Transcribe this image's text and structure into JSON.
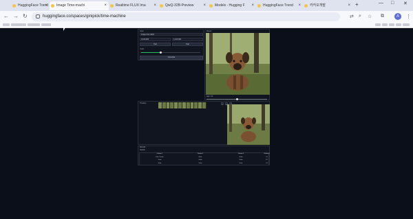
{
  "browser": {
    "tabs": [
      {
        "label": "HuggingFace Trend"
      },
      {
        "label": "Image Time-machi"
      },
      {
        "label": "Realtime FLUX Ima"
      },
      {
        "label": "QwQ-32B-Preview"
      },
      {
        "label": "Models - Hugging F"
      },
      {
        "label": "HuggingFace Trend"
      },
      {
        "label": "카카오개발"
      }
    ],
    "url": "huggingface.co/spaces/ginipick/time-machine",
    "avatar_letter": "A",
    "new_tab_symbol": "+",
    "back_symbol": "←",
    "forward_symbol": "→",
    "reload_symbol": "↻",
    "minimize_symbol": "—",
    "maximize_symbol": "□",
    "close_symbol": "✕",
    "tab_close_symbol": "×",
    "translate_icon_glyph": "⇄",
    "zoom_icon_glyph": "⌕",
    "star_icon_glyph": "☆",
    "extensions_icon_glyph": "⧉",
    "menu_icon_glyph": "⋮"
  },
  "app": {
    "controls": {
      "input_label": "Input",
      "input_value": "Image from 2024",
      "value_left": "2,100,000",
      "value_right": "1,100,000",
      "sub_left": "Year",
      "sub_right": "Year",
      "slider_label": "Years",
      "slider_value": 0.33,
      "generate_label": "Generate"
    },
    "top_image_label": "Result",
    "top_image_caption": "Age: 0.0",
    "top_slider_value": 0.5,
    "strip_label": "Timeline",
    "strip_frame_count": 12,
    "mid_buttons": [
      "−",
      "+",
      "⤢"
    ],
    "table": {
      "title": "Results",
      "subtitle": "Details",
      "columns": [
        "Column 1",
        "Column 2",
        "Column 3",
        "Column 4"
      ],
      "rows": [
        [
          "Row 1 Value",
          "Value",
          "Value",
          "01"
        ],
        [
          "Value",
          "Value",
          "Value",
          "02"
        ],
        [
          "Value",
          "Value",
          "Value",
          "03"
        ]
      ]
    }
  },
  "colors": {
    "page_bg": "#0b0f19",
    "accent_green": "#22c55e"
  }
}
